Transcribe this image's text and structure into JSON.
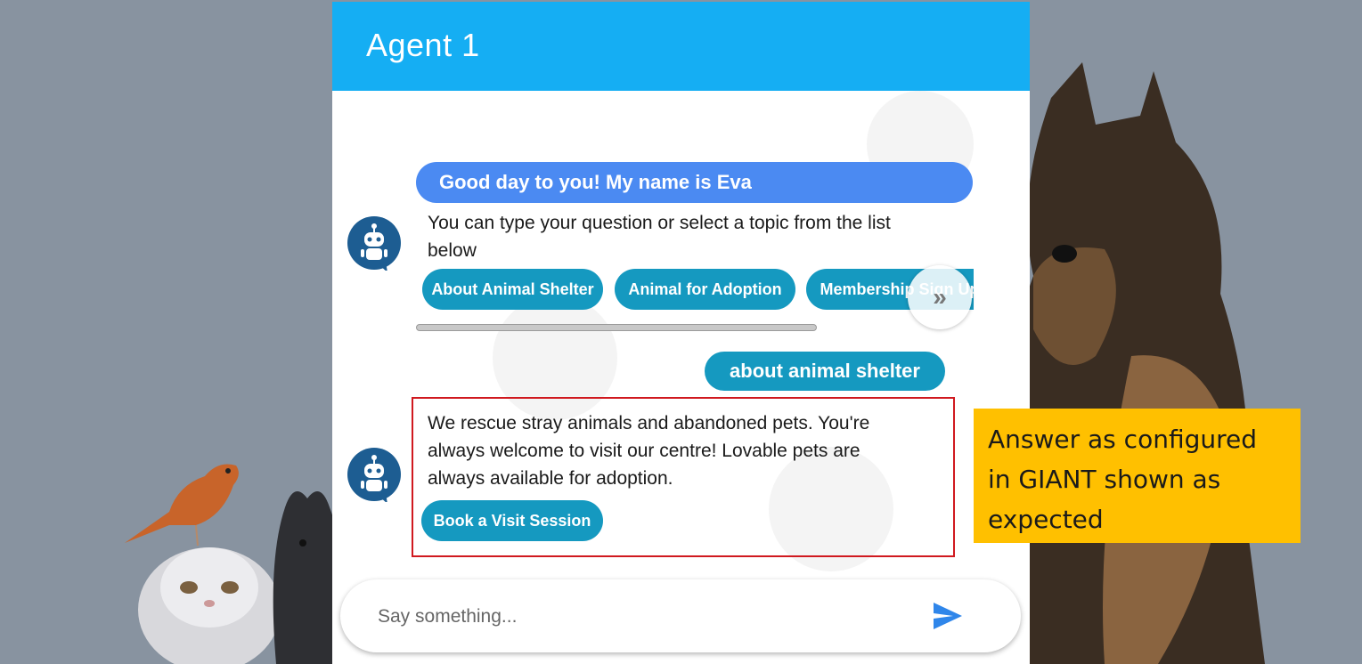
{
  "header": {
    "title": "Agent 1"
  },
  "messages": {
    "greeting": "Good day to you! My name is Eva",
    "intro_line1": "You can type your question or select a topic from the list",
    "intro_line2": "below",
    "topics": [
      "About Animal Shelter",
      "Animal for Adoption",
      "Membership Sign Up"
    ],
    "user_message": "about animal shelter",
    "answer_line1": "We rescue stray animals and abandoned pets. You're",
    "answer_line2": "always welcome to visit our centre! Lovable pets are",
    "answer_line3": "always available for adoption.",
    "answer_button": "Book a Visit Session"
  },
  "input": {
    "placeholder": "Say something..."
  },
  "callout": {
    "line1": "Answer as configured",
    "line2": "in GIANT shown as",
    "line3": "expected"
  },
  "icons": {
    "avatar": "robot-icon",
    "scroll": "double-chevron-right-icon",
    "send": "send-icon"
  },
  "colors": {
    "header": "#15aef3",
    "greeting_bubble": "#4b8af2",
    "chip": "#1599c0",
    "highlight_border": "#d0191f",
    "callout": "#ffc000"
  }
}
